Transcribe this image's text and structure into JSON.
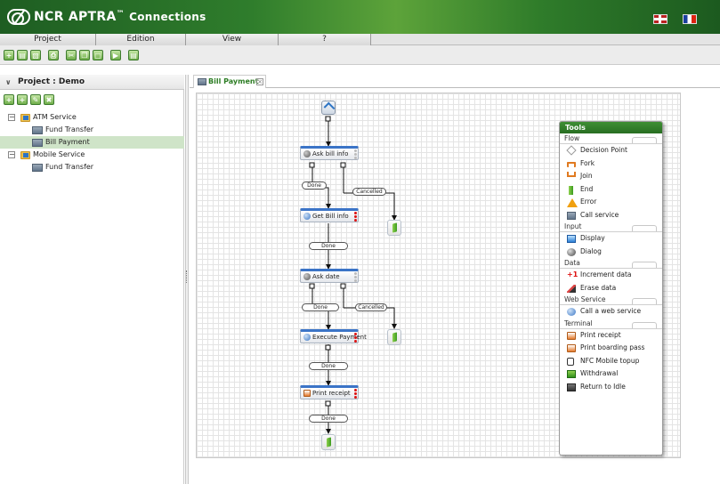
{
  "app": {
    "brand": "NCR",
    "product": "APTRA",
    "trademark": "™",
    "subtitle": "Connections"
  },
  "languages": [
    "English",
    "Français"
  ],
  "menu": [
    "Project",
    "Edition",
    "View",
    "?"
  ],
  "toolbar": {
    "icons": [
      "add-icon",
      "grid-icon",
      "save-icon",
      "print-icon",
      "cut-icon",
      "copy-icon",
      "paste-icon",
      "run-icon",
      "export-icon"
    ]
  },
  "project_panel": {
    "title": "Project : Demo",
    "tools": [
      "add-icon",
      "add-child-icon",
      "edit-icon",
      "delete-icon"
    ],
    "tree": [
      {
        "label": "ATM Service",
        "type": "folder",
        "expander": "−"
      },
      {
        "label": "Fund Transfer",
        "type": "service"
      },
      {
        "label": "Bill Payment",
        "type": "service",
        "selected": true
      },
      {
        "label": "Mobile Service",
        "type": "folder",
        "expander": "−"
      },
      {
        "label": "Fund Transfer",
        "type": "service"
      }
    ]
  },
  "tab": {
    "label": "Bill Payment",
    "close": "×"
  },
  "flow": {
    "nodes": [
      {
        "label": "Ask bill info"
      },
      {
        "label": "Get Bill info"
      },
      {
        "label": "Ask date"
      },
      {
        "label": "Execute Payment"
      },
      {
        "label": "Print receipt"
      }
    ],
    "edge_labels": [
      "Done",
      "Cancelled",
      "Done",
      "Done",
      "Cancelled",
      "Done",
      "Done"
    ]
  },
  "tools": {
    "title": "Tools",
    "sections": [
      {
        "name": "Flow",
        "items": [
          "Decision Point",
          "Fork",
          "Join",
          "End",
          "Error",
          "Call service"
        ]
      },
      {
        "name": "Input",
        "items": [
          "Display",
          "Dialog"
        ]
      },
      {
        "name": "Data",
        "items": [
          "Increment data",
          "Erase data"
        ]
      },
      {
        "name": "Web Service",
        "items": [
          "Call a web service"
        ]
      },
      {
        "name": "Terminal",
        "items": [
          "Print receipt",
          "Print boarding pass",
          "NFC Mobile topup",
          "Withdrawal",
          "Return to Idle"
        ]
      }
    ]
  }
}
